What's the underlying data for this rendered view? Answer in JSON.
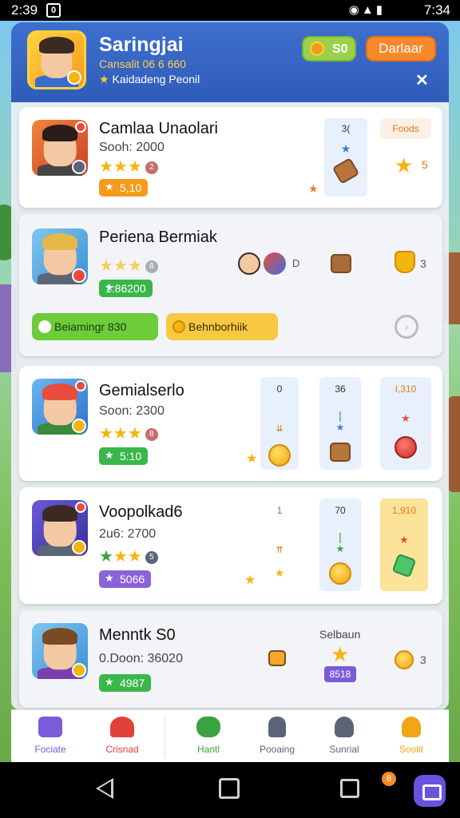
{
  "status_bar": {
    "time_left": "2:39",
    "notif_icon": "0",
    "time_right": "7:34"
  },
  "header": {
    "player_name": "Saringjai",
    "player_subtitle": "Cansalit 06 6 660",
    "player_rank": "Kaidadeng Peonil",
    "coin_value": "S0",
    "action_label": "Darlaar"
  },
  "cards": [
    {
      "name": "Camlaa Unaolari",
      "sub": "Sooh: 2000",
      "stars_badge": "2",
      "pill": "5,10",
      "col1_label": "3(",
      "col2_label": "Foods",
      "col2_value": "5"
    },
    {
      "name": "Periena Bermiak",
      "stars_badge": "8",
      "pill": "1:86200",
      "col1_label": "D",
      "col2_value": "3",
      "chip_green": "Beiamingr 830",
      "chip_yellow": "Behnborhiik"
    },
    {
      "name": "Gemialserlo",
      "sub": "Soon: 2300",
      "stars_badge": "8",
      "pill": "5:10",
      "col1_label": "0",
      "col2_label": "36",
      "col3_label": "I,310"
    },
    {
      "name": "Voopolkad6",
      "sub": "2u6: 2700",
      "stars_badge": "5",
      "pill": "5066",
      "col1_label": "1",
      "col2_label": "70",
      "col3_label": "1,910"
    },
    {
      "name": "Menntk S0",
      "sub": "0.Doon: 36020",
      "pill": "4987",
      "col_header": "Selbaun",
      "badge": "8518",
      "col2_value": "3"
    }
  ],
  "tabs": [
    {
      "label": "Fociate",
      "color": "#7a5bd9"
    },
    {
      "label": "Crisnad",
      "color": "#e2413a"
    },
    {
      "label": "Hantl",
      "color": "#3aa23f"
    },
    {
      "label": "Pooaing",
      "color": "#5b6477"
    },
    {
      "label": "Sunrial",
      "color": "#5b6477"
    },
    {
      "label": "Soolit",
      "color": "#f2a516"
    }
  ],
  "nav": {
    "badge": "8"
  }
}
